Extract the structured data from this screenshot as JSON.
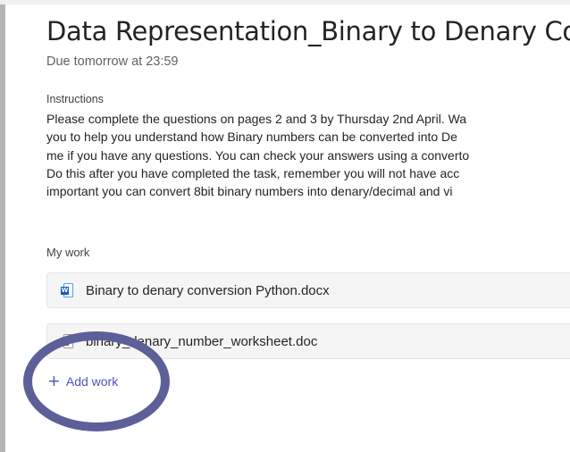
{
  "assignment": {
    "title": "Data Representation_Binary to Denary Con",
    "due": "Due tomorrow at 23:59"
  },
  "instructions": {
    "label": "Instructions",
    "lines": [
      "Please complete the questions on pages 2 and 3 by Thursday 2nd April. Wa",
      "you to help you understand how Binary numbers can be converted into De",
      "me if you have any questions. You can check your answers using a converto",
      "Do this after you have completed the task, remember you will not have acc",
      "important you can convert 8bit binary numbers into denary/decimal and vi"
    ]
  },
  "my_work": {
    "label": "My work",
    "files": [
      {
        "name": "Binary to denary conversion Python.docx",
        "icon": "word-doc-icon"
      },
      {
        "name": "binary_denary_number_worksheet.doc",
        "icon": "word-doc-icon"
      }
    ],
    "add_work_label": "Add work",
    "add_icon": "+"
  },
  "colors": {
    "accent": "#5b5fc7",
    "highlight_ring": "#5d5f99"
  }
}
